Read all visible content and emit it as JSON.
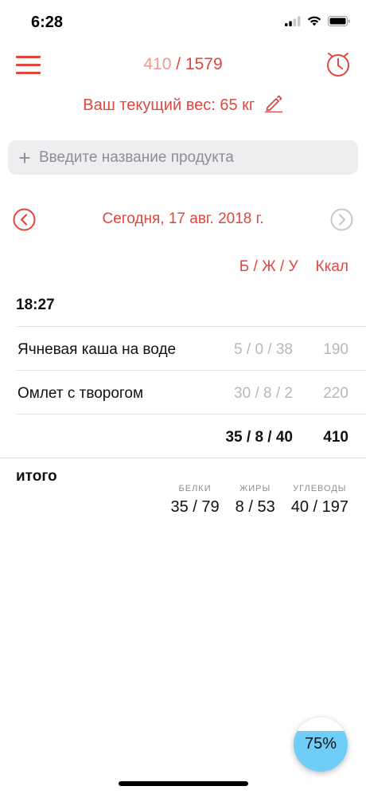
{
  "status_bar": {
    "time": "6:28"
  },
  "nav": {
    "calories_eaten": "410",
    "separator": " / ",
    "calories_goal": "1579",
    "menu_icon": "hamburger-icon",
    "history_icon": "clock-history-icon"
  },
  "weight": {
    "label": "Ваш текущий вес:",
    "value": "65 кг"
  },
  "search": {
    "placeholder": "Введите название продукта",
    "value": ""
  },
  "date_nav": {
    "label": "Сегодня, 17 авг. 2018 г."
  },
  "columns": {
    "macros": "Б / Ж / У",
    "kcal": "Ккал"
  },
  "meal": {
    "time": "18:27",
    "items": [
      {
        "name": "Ячневая каша на воде",
        "macros": "5 / 0 / 38",
        "kcal": "190"
      },
      {
        "name": "Омлет с творогом",
        "macros": "30 / 8 / 2",
        "kcal": "220"
      }
    ],
    "subtotal": {
      "macros": "35 / 8 / 40",
      "kcal": "410"
    }
  },
  "totals": {
    "label": "итого",
    "protein": {
      "caption": "БЕЛКИ",
      "value": "35 / 79"
    },
    "fat": {
      "caption": "ЖИРЫ",
      "value": "8 / 53"
    },
    "carbs": {
      "caption": "УГЛЕВОДЫ",
      "value": "40 / 197"
    }
  },
  "progress": {
    "label": "75%",
    "fraction": 0.75
  },
  "colors": {
    "accent": "#e0473e",
    "accent_light": "#ec9a93",
    "progress_fill": "#6fcdf7"
  }
}
